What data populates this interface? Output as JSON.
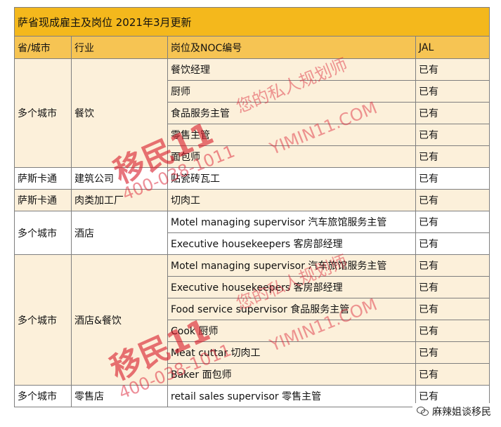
{
  "table": {
    "title": "萨省现成雇主及岗位  2021年3月更新",
    "headers": [
      "省/城市",
      "行业",
      "岗位及NOC编号",
      "JAL"
    ],
    "groups": [
      {
        "province": "多个城市",
        "industry": "餐饮",
        "shade": true,
        "jobs": [
          {
            "job": "餐饮经理",
            "jal": "已有"
          },
          {
            "job": "厨师",
            "jal": "已有"
          },
          {
            "job": "食品服务主管",
            "jal": "已有"
          },
          {
            "job": "零售主管",
            "jal": "已有"
          },
          {
            "job": "面包师",
            "jal": "已有"
          }
        ]
      },
      {
        "province": "萨斯卡通",
        "industry": "建筑公司",
        "shade": false,
        "jobs": [
          {
            "job": "贴瓷砖瓦工",
            "jal": "已有"
          }
        ]
      },
      {
        "province": "萨斯卡通",
        "industry": "肉类加工厂",
        "shade": true,
        "jobs": [
          {
            "job": "切肉工",
            "jal": "已有"
          }
        ]
      },
      {
        "province": "多个城市",
        "industry": "酒店",
        "shade": false,
        "jobs": [
          {
            "job": "Motel managing supervisor 汽车旅馆服务主管",
            "jal": "已有"
          },
          {
            "job": "Executive housekeepers  客房部经理",
            "jal": "已有"
          }
        ]
      },
      {
        "province": "多个城市",
        "industry": "酒店&餐饮",
        "shade": true,
        "jobs": [
          {
            "job": "Motel managing supervisor 汽车旅馆服务主管",
            "jal": "已有"
          },
          {
            "job": "Executive housekeepers  客房部经理",
            "jal": "已有"
          },
          {
            "job": "Food service supervisor 食品服务主管",
            "jal": "已有"
          },
          {
            "job": "Cook 厨师",
            "jal": "已有"
          },
          {
            "job": "Meat cuttar 切肉工",
            "jal": "已有"
          },
          {
            "job": "Baker 面包师",
            "jal": "已有"
          }
        ]
      },
      {
        "province": "多个城市",
        "industry": "零售店",
        "shade": false,
        "jobs": [
          {
            "job": "retail sales supervisor 零售主管",
            "jal": "已有"
          }
        ]
      }
    ]
  },
  "watermark": {
    "brand": "移民11",
    "slogan": "您的私人规划师",
    "site": "YIMIN11.COM",
    "phone": "400-038-1011"
  },
  "badge": {
    "icon": "wechat-icon",
    "text": "麻辣姐谈移民"
  },
  "colors": {
    "title_bg": "#f4b81c",
    "header_bg": "#f6c453",
    "shade_bg": "#fcf0da",
    "watermark": "#d71928"
  }
}
